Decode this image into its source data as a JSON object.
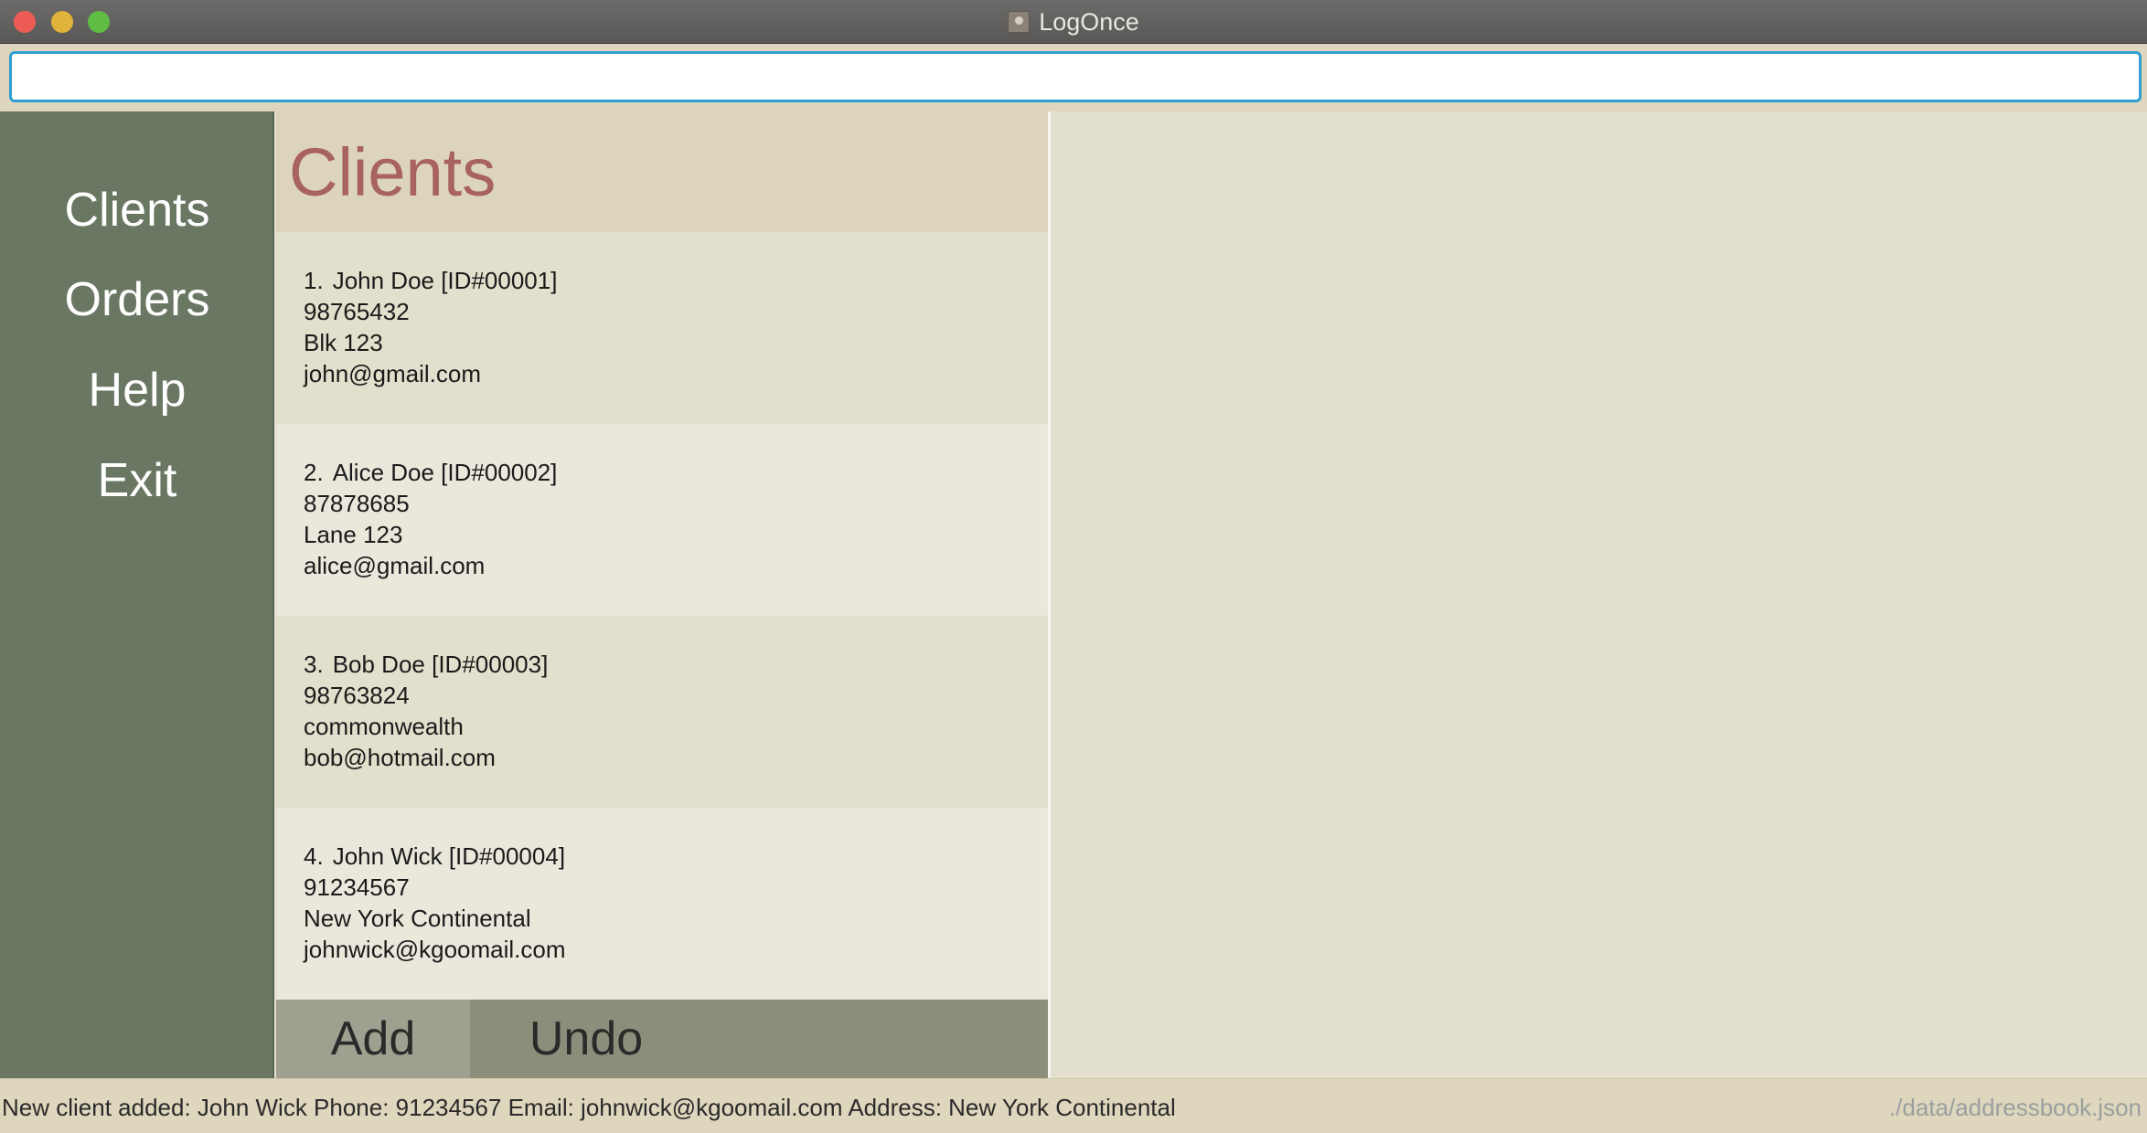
{
  "window": {
    "title": "LogOnce"
  },
  "command": {
    "value": "",
    "placeholder": ""
  },
  "sidebar": {
    "items": [
      {
        "label": "Clients"
      },
      {
        "label": "Orders"
      },
      {
        "label": "Help"
      },
      {
        "label": "Exit"
      }
    ]
  },
  "clients": {
    "title": "Clients",
    "items": [
      {
        "index": "1.",
        "name": "John Doe [ID#00001]",
        "phone": "98765432",
        "address": "Blk 123",
        "email": "john@gmail.com"
      },
      {
        "index": "2.",
        "name": "Alice Doe [ID#00002]",
        "phone": "87878685",
        "address": "Lane 123",
        "email": "alice@gmail.com"
      },
      {
        "index": "3.",
        "name": "Bob Doe [ID#00003]",
        "phone": "98763824",
        "address": "commonwealth",
        "email": "bob@hotmail.com"
      },
      {
        "index": "4.",
        "name": "John Wick [ID#00004]",
        "phone": "91234567",
        "address": "New York Continental",
        "email": "johnwick@kgoomail.com"
      }
    ],
    "buttons": {
      "add": "Add",
      "undo": "Undo"
    }
  },
  "status": {
    "message": "New client added: John Wick Phone: 91234567 Email: johnwick@kgoomail.com Address: New York Continental",
    "path": "./data/addressbook.json"
  },
  "colors": {
    "sidebar": "#6a7763",
    "title_accent": "#a8625f",
    "input_border": "#2f9ed0"
  }
}
